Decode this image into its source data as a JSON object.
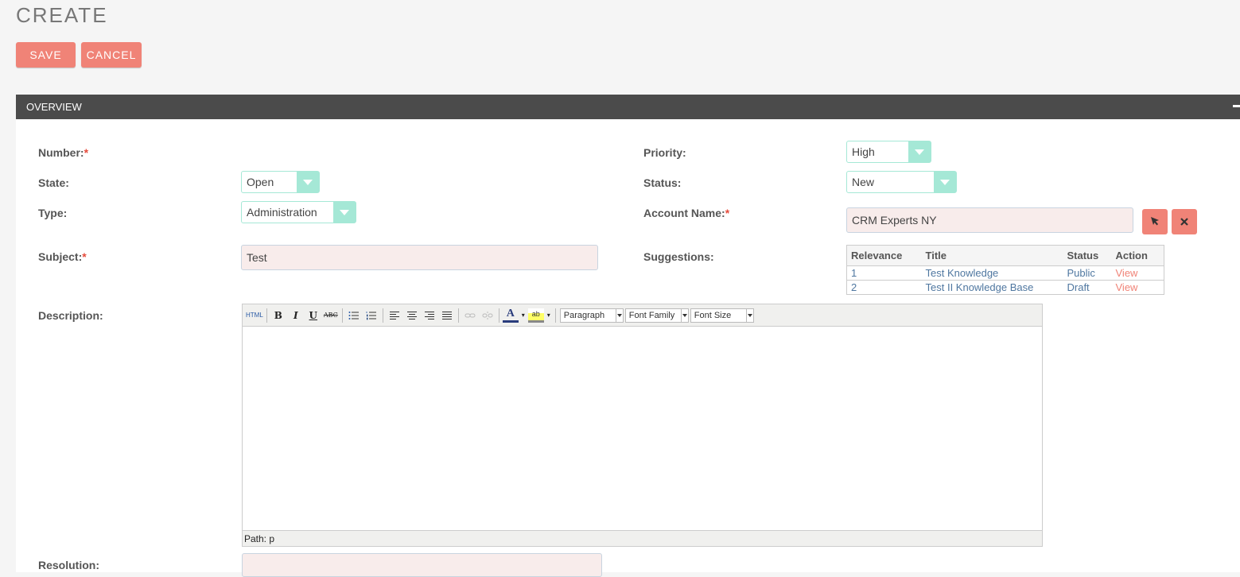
{
  "page": {
    "title": "CREATE"
  },
  "actions": {
    "save_label": "SAVE",
    "cancel_label": "CANCEL"
  },
  "panel": {
    "title": "OVERVIEW"
  },
  "fields": {
    "number": {
      "label": "Number:",
      "required": "*"
    },
    "state": {
      "label": "State:",
      "value": "Open"
    },
    "type": {
      "label": "Type:",
      "value": "Administration"
    },
    "subject": {
      "label": "Subject:",
      "required": "*",
      "value": "Test"
    },
    "description": {
      "label": "Description:"
    },
    "resolution": {
      "label": "Resolution:"
    },
    "priority": {
      "label": "Priority:",
      "value": "High"
    },
    "status": {
      "label": "Status:",
      "value": "New"
    },
    "account_name": {
      "label": "Account Name:",
      "required": "*",
      "value": "CRM Experts NY"
    },
    "suggestions": {
      "label": "Suggestions:"
    }
  },
  "suggestions_table": {
    "headers": [
      "Relevance",
      "Title",
      "Status",
      "Action"
    ],
    "rows": [
      {
        "relevance": "1",
        "title": "Test Knowledge",
        "status": "Public",
        "action": "View"
      },
      {
        "relevance": "2",
        "title": "Test II Knowledge Base",
        "status": "Draft",
        "action": "View"
      }
    ]
  },
  "editor": {
    "toolbar": {
      "html_label": "HTML",
      "bold": "B",
      "italic": "I",
      "underline": "U",
      "strike": "ABC",
      "font_color": "A",
      "highlight": "ab",
      "format_select": "Paragraph",
      "family_select": "Font Family",
      "size_select": "Font Size"
    },
    "path_text": "Path: p"
  },
  "colors": {
    "accent": "#f08377",
    "select_border": "#a5e8d6",
    "header_bar": "#4b4b4b"
  }
}
